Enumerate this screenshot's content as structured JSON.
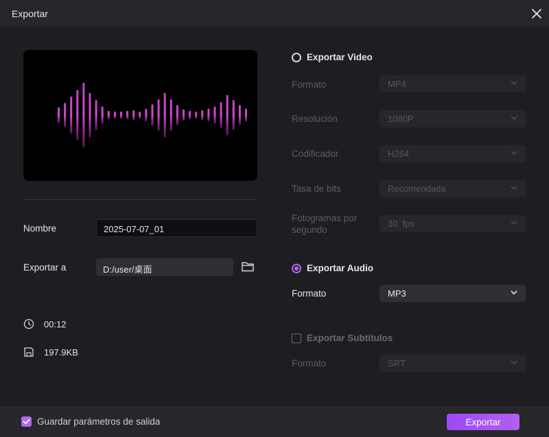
{
  "window": {
    "title": "Exportar"
  },
  "left": {
    "name_label": "Nombre",
    "name_value": "2025-07-07_01",
    "export_to_label": "Exportar a",
    "export_path": "D:/user/桌面",
    "duration": "00:12",
    "size": "197.9KB"
  },
  "video": {
    "label": "Exportar Video",
    "selected": false,
    "fields": [
      {
        "label": "Formato",
        "value": "MP4"
      },
      {
        "label": "Resolución",
        "value": "1080P"
      },
      {
        "label": "Codificador",
        "value": "H264"
      },
      {
        "label": "Tasa de bits",
        "value": "Recomendada"
      },
      {
        "label_line1": "Fotogramas por",
        "label_line2": "segundo",
        "value": "30  fps"
      }
    ]
  },
  "audio": {
    "label": "Exportar Audio",
    "selected": true,
    "format_label": "Formato",
    "format_value": "MP3"
  },
  "subtitles": {
    "label": "Exportar Subtítulos",
    "checked": false,
    "format_label": "Formato",
    "format_value": "SRT"
  },
  "footer": {
    "save_params_label": "Guardar parámetros de salida",
    "save_params_checked": true,
    "export_button": "Exportar"
  },
  "colors": {
    "accent": "#b466f0",
    "button": "#a050f2",
    "wave_top": "#c642c6",
    "wave_bottom": "#8a1e8a"
  },
  "icons": {
    "close": "close-icon",
    "folder": "folder-icon",
    "clock": "clock-icon",
    "disk": "save-disk-icon",
    "chevron": "chevron-down-icon",
    "check": "checkmark-icon"
  },
  "waveform": {
    "bars": [
      0.22,
      0.34,
      0.52,
      0.7,
      0.9,
      0.62,
      0.42,
      0.24,
      0.12,
      0.1,
      0.1,
      0.12,
      0.14,
      0.1,
      0.18,
      0.3,
      0.44,
      0.62,
      0.44,
      0.28,
      0.16,
      0.12,
      0.1,
      0.14,
      0.18,
      0.24,
      0.36,
      0.56,
      0.42,
      0.28,
      0.18
    ]
  }
}
